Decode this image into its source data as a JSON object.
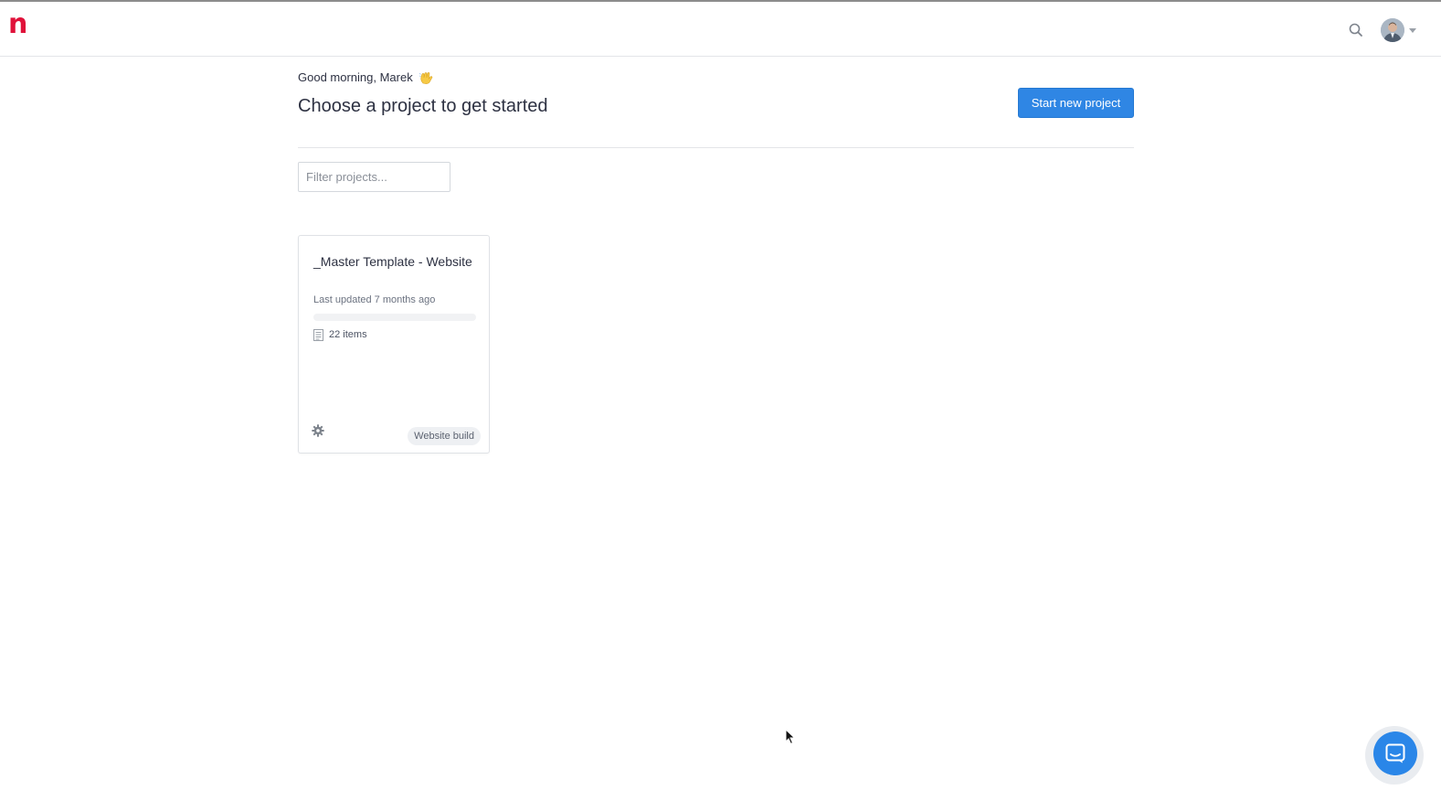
{
  "app": {
    "logo_text": "n",
    "brand_color": "#e0123a",
    "accent_color": "#2f86e4"
  },
  "header": {
    "search_icon": "search-icon",
    "avatar_icon": "user-avatar",
    "caret_icon": "chevron-down-icon"
  },
  "main": {
    "greeting": "Good morning, Marek",
    "greeting_icon": "waving-hand-icon",
    "title": "Choose a project to get started",
    "start_button_label": "Start new project",
    "filter_placeholder": "Filter projects..."
  },
  "projects": [
    {
      "title": "_Master Template - Website",
      "updated": "Last updated 7 months ago",
      "progress": 0,
      "items_count": "22 items",
      "tag": "Website build",
      "settings_icon": "gear-icon"
    }
  ],
  "support": {
    "chat_icon": "chat-icon"
  }
}
